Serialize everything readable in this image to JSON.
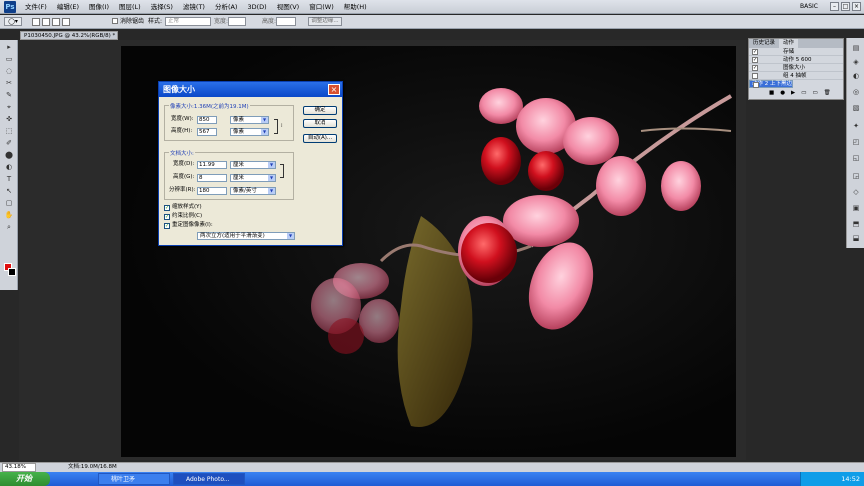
{
  "app": {
    "logo": "Ps",
    "menus": [
      "文件(F)",
      "编辑(E)",
      "图像(I)",
      "图层(L)",
      "选择(S)",
      "滤镜(T)",
      "分析(A)",
      "3D(D)",
      "视图(V)",
      "窗口(W)",
      "帮助(H)"
    ],
    "workspace_name": "BASIC",
    "win_buttons": [
      "–",
      "□",
      "×"
    ]
  },
  "options_bar": {
    "antialias_label": "消除锯齿",
    "style_label": "样式:",
    "style_value": "正常",
    "width_label": "宽度:",
    "height_label": "高度:",
    "refine_edge": "调整边缘..."
  },
  "document": {
    "tab_title": "P1030450.JPG @ 43.2%(RGB/8) *",
    "zoom": "43.18%",
    "doc_size": "文档:19.0M/16.8M"
  },
  "tools": [
    "▸",
    "▭",
    "◌",
    "✂",
    "✎",
    "⌖",
    "✜",
    "⬚",
    "✐",
    "⬤",
    "◐",
    "T",
    "↖",
    "▢",
    "✋",
    "⌕"
  ],
  "actions_panel": {
    "tabs": [
      "历史记录",
      "动作"
    ],
    "rows": [
      {
        "label": "存储",
        "checked": true,
        "selected": false
      },
      {
        "label": "动作 5  600",
        "checked": true,
        "selected": false
      },
      {
        "label": "图像大小",
        "checked": true,
        "selected": false
      },
      {
        "label": "组 4  抽帧",
        "checked": false,
        "selected": false
      },
      {
        "label": "动作 2  上下黑边",
        "checked": true,
        "selected": true
      }
    ],
    "bottom_icons": [
      "■",
      "●",
      "▶",
      "▭",
      "▭",
      "🗑"
    ]
  },
  "right_icons": [
    "▤",
    "◈",
    "◐",
    "◎",
    "▧",
    "✦",
    "◰",
    "◱",
    "◲",
    "◇",
    "▣",
    "⬒",
    "⬓"
  ],
  "dialog": {
    "title": "图像大小",
    "close": "×",
    "pixel_group_label": "像素大小:1.36M(之前为19.1M)",
    "width_label": "宽度(W):",
    "width_value": "850",
    "height_label": "高度(H):",
    "height_value": "567",
    "pixel_unit": "像素",
    "doc_group_label": "文档大小:",
    "doc_width_label": "宽度(D):",
    "doc_width_value": "11.99",
    "doc_height_label": "高度(G):",
    "doc_height_value": "8",
    "cm_unit": "厘米",
    "res_label": "分辨率(R):",
    "res_value": "180",
    "res_unit": "像素/英寸",
    "scale_styles": "缩放样式(Y)",
    "constrain": "约束比例(C)",
    "resample": "重定图像像素(I):",
    "resample_method": "两次立方(适用于平滑渐变)",
    "ok": "确定",
    "cancel": "取消",
    "auto": "自动(A)...",
    "annot_1": "1",
    "annot_2": "2"
  },
  "taskbar": {
    "start": "开始",
    "tasks": [
      "桃叶卫矛",
      "Adobe Photo..."
    ],
    "time": "14:52"
  },
  "colors": {
    "foreground": "#e01010",
    "background": "#000000",
    "annotation": "#d8202a"
  }
}
